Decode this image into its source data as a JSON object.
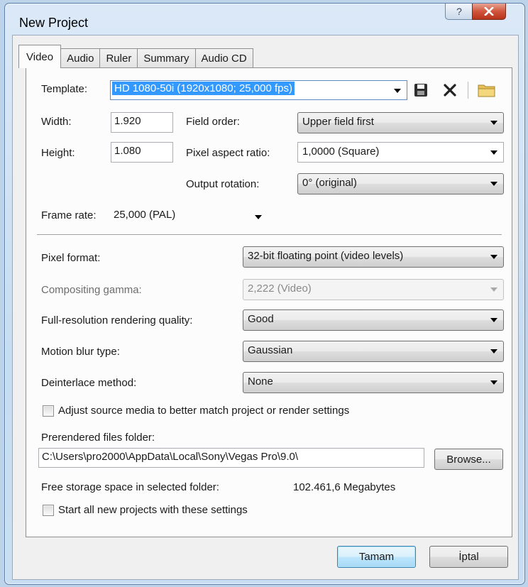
{
  "window": {
    "title": "New Project",
    "help_glyph": "?"
  },
  "tabs": [
    "Video",
    "Audio",
    "Ruler",
    "Summary",
    "Audio CD"
  ],
  "template": {
    "label": "Template:",
    "value": "HD 1080-50i (1920x1080; 25,000 fps)"
  },
  "width": {
    "label": "Width:",
    "value": "1.920"
  },
  "height": {
    "label": "Height:",
    "value": "1.080"
  },
  "field_order": {
    "label": "Field order:",
    "value": "Upper field first"
  },
  "pixel_aspect": {
    "label": "Pixel aspect ratio:",
    "value": "1,0000 (Square)"
  },
  "output_rotation": {
    "label": "Output rotation:",
    "value": "0° (original)"
  },
  "frame_rate": {
    "label": "Frame rate:",
    "value": "25,000 (PAL)"
  },
  "pixel_format": {
    "label": "Pixel format:",
    "value": "32-bit floating point (video levels)"
  },
  "compositing_gamma": {
    "label": "Compositing gamma:",
    "value": "2,222 (Video)"
  },
  "rendering_quality": {
    "label": "Full-resolution rendering quality:",
    "value": "Good"
  },
  "motion_blur": {
    "label": "Motion blur type:",
    "value": "Gaussian"
  },
  "deinterlace": {
    "label": "Deinterlace method:",
    "value": "None"
  },
  "adjust_source": {
    "label": "Adjust source media to better match project or render settings",
    "checked": false
  },
  "prerendered": {
    "label": "Prerendered files folder:",
    "path": "C:\\Users\\pro2000\\AppData\\Local\\Sony\\Vegas Pro\\9.0\\",
    "browse": "Browse..."
  },
  "storage": {
    "label": "Free storage space in selected folder:",
    "value": "102.461,6 Megabytes"
  },
  "start_all": {
    "label": "Start all new projects with these settings",
    "checked": false
  },
  "buttons": {
    "ok": "Tamam",
    "cancel": "İptal"
  },
  "colors": {
    "selection": "#3399ff",
    "close_button": "#c94a32"
  },
  "icons": [
    "save-icon",
    "delete-icon",
    "folder-icon",
    "help-icon",
    "close-icon"
  ]
}
